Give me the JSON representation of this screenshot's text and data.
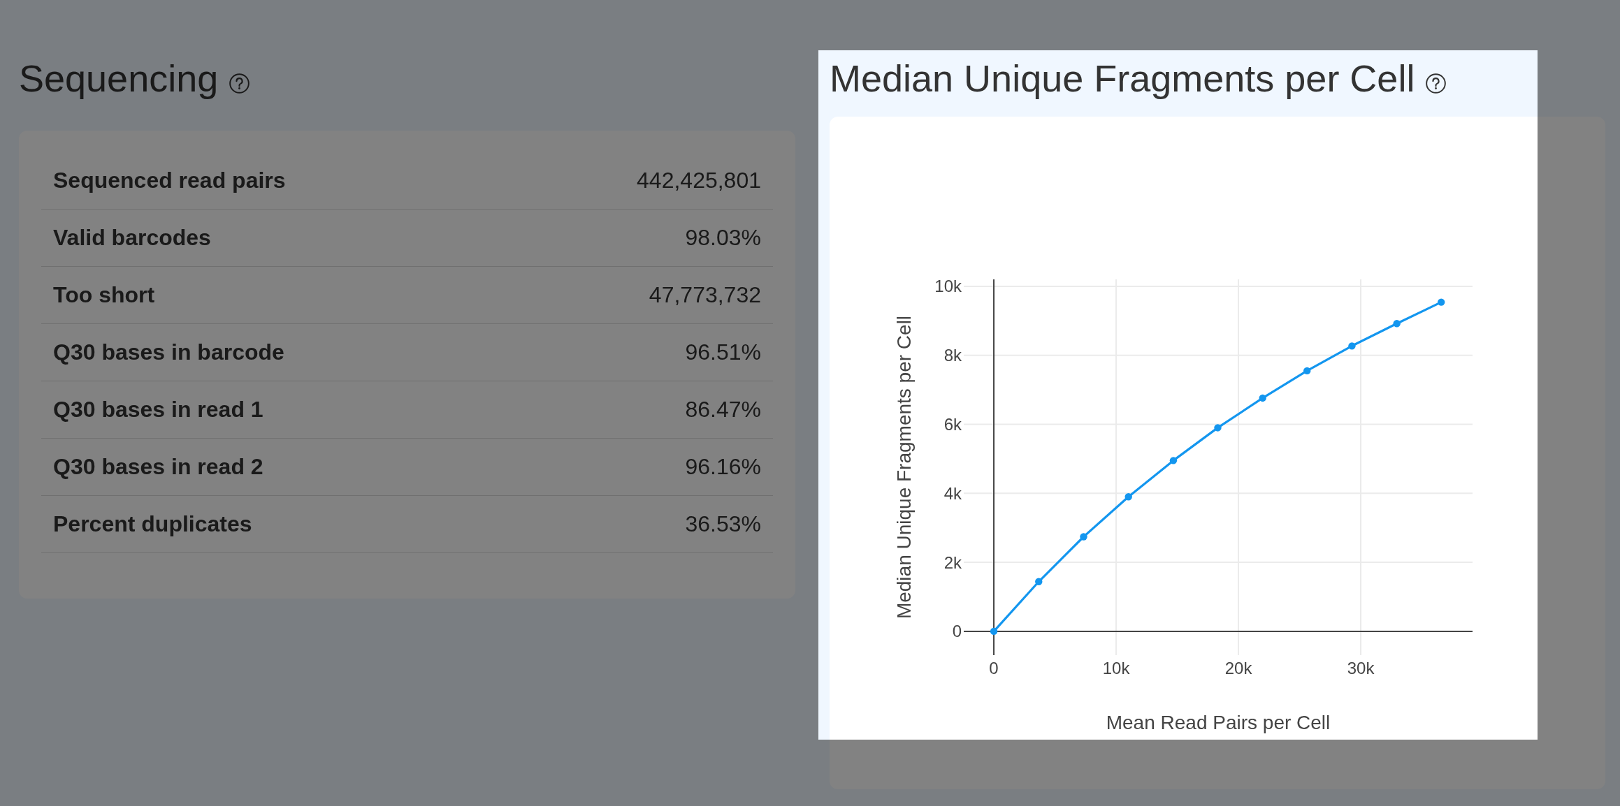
{
  "sections": [
    {
      "kind": "table",
      "title": "Sequencing",
      "help_icon": true,
      "highlighted": false,
      "rows": [
        {
          "label": "Sequenced read pairs",
          "value": "442,425,801"
        },
        {
          "label": "Valid barcodes",
          "value": "98.03%"
        },
        {
          "label": "Too short",
          "value": "47,773,732"
        },
        {
          "label": "Q30 bases in barcode",
          "value": "96.51%"
        },
        {
          "label": "Q30 bases in read 1",
          "value": "86.47%"
        },
        {
          "label": "Q30 bases in read 2",
          "value": "96.16%"
        },
        {
          "label": "Percent duplicates",
          "value": "36.53%"
        }
      ]
    },
    {
      "kind": "chart",
      "title": "Median Unique Fragments per Cell",
      "help_icon": true,
      "highlighted": true,
      "chart_data": {
        "type": "line",
        "xlabel": "Mean Read Pairs per Cell",
        "ylabel": "Median Unique Fragments per Cell",
        "grid": true,
        "x": [
          0,
          3670,
          7340,
          11010,
          14680,
          18310,
          21980,
          25610,
          29280,
          32950,
          36580
        ],
        "series": [
          {
            "color": "#1396ef",
            "marker": true,
            "values": [
              0,
              1440,
              2740,
              3900,
              4950,
              5900,
              6760,
              7550,
              8270,
              8920,
              9540
            ]
          }
        ],
        "xlim": [
          -2460,
          39140
        ],
        "ylim": [
          -690,
          10200
        ],
        "xticks": [
          {
            "value": 0,
            "label": "0"
          },
          {
            "value": 10000,
            "label": "10k"
          },
          {
            "value": 20000,
            "label": "20k"
          },
          {
            "value": 30000,
            "label": "30k"
          }
        ],
        "yticks": [
          {
            "value": 0,
            "label": "0"
          },
          {
            "value": 2000,
            "label": "2k"
          },
          {
            "value": 4000,
            "label": "4k"
          },
          {
            "value": 6000,
            "label": "6k"
          },
          {
            "value": 8000,
            "label": "8k"
          },
          {
            "value": 10000,
            "label": "10k"
          }
        ]
      }
    }
  ]
}
